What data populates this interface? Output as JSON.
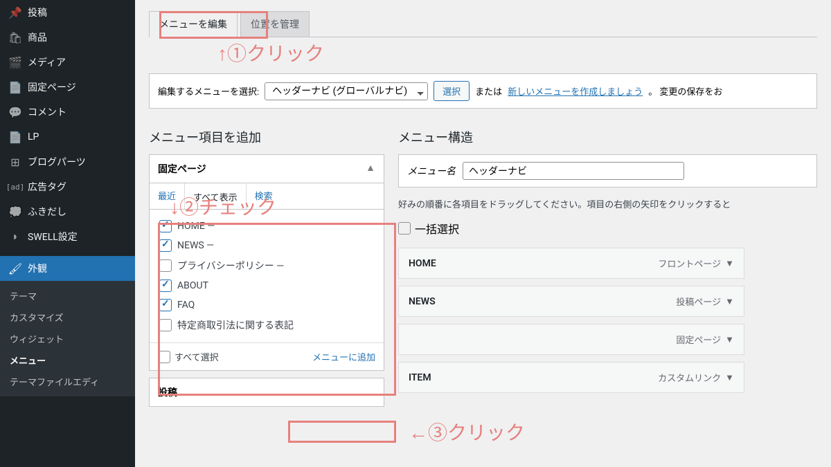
{
  "sidebar": {
    "items": [
      {
        "icon": "📌",
        "label": "投稿"
      },
      {
        "icon": "🛒",
        "label": "商品"
      },
      {
        "icon": "🖼",
        "label": "メディア"
      },
      {
        "icon": "📄",
        "label": "固定ページ"
      },
      {
        "icon": "💬",
        "label": "コメント"
      },
      {
        "icon": "📄",
        "label": "LP"
      },
      {
        "icon": "⊞",
        "label": "ブログパーツ"
      },
      {
        "icon": "[ad]",
        "label": "広告タグ"
      },
      {
        "icon": "💭",
        "label": "ふきだし"
      },
      {
        "icon": "◗",
        "label": "SWELL設定"
      }
    ],
    "active": {
      "icon": "🖌",
      "label": "外観"
    },
    "submenu": [
      "テーマ",
      "カスタマイズ",
      "ウィジェット",
      "メニュー",
      "テーマファイルエディ"
    ]
  },
  "tabs": {
    "active": "メニューを編集",
    "other": "位置を管理"
  },
  "selector": {
    "label": "編集するメニューを選択:",
    "value": "ヘッダーナビ (グローバルナビ)",
    "button": "選択",
    "or": "または",
    "link": "新しいメニューを作成しましょう",
    "suffix": "。 変更の保存をお"
  },
  "left": {
    "title": "メニュー項目を追加",
    "panel_title": "固定ページ",
    "subtabs": {
      "recent": "最近",
      "all": "すべて表示",
      "search": "検索"
    },
    "items": [
      {
        "label": "HOME —",
        "checked": true
      },
      {
        "label": "NEWS —",
        "checked": true
      },
      {
        "label": "プライバシーポリシー —",
        "checked": false
      },
      {
        "label": "ABOUT",
        "checked": true
      },
      {
        "label": "FAQ",
        "checked": true
      },
      {
        "label": "特定商取引法に関する表記",
        "checked": false
      }
    ],
    "select_all": "すべて選択",
    "add_button": "メニューに追加",
    "next_panel": "投稿"
  },
  "right": {
    "title": "メニュー構造",
    "name_label": "メニュー名",
    "name_value": "ヘッダーナビ",
    "help": "好みの順番に各項目をドラッグしてください。項目の右側の矢印をクリックすると",
    "bulk": "一括選択",
    "items": [
      {
        "label": "HOME",
        "type": "フロントページ"
      },
      {
        "label": "NEWS",
        "type": "投稿ページ"
      },
      {
        "label": "",
        "type": "固定ページ"
      },
      {
        "label": "ITEM",
        "type": "カスタムリンク"
      }
    ]
  },
  "annotations": {
    "a1": "↑①クリック",
    "a2": "↓②チェック",
    "a3": "←③クリック"
  }
}
